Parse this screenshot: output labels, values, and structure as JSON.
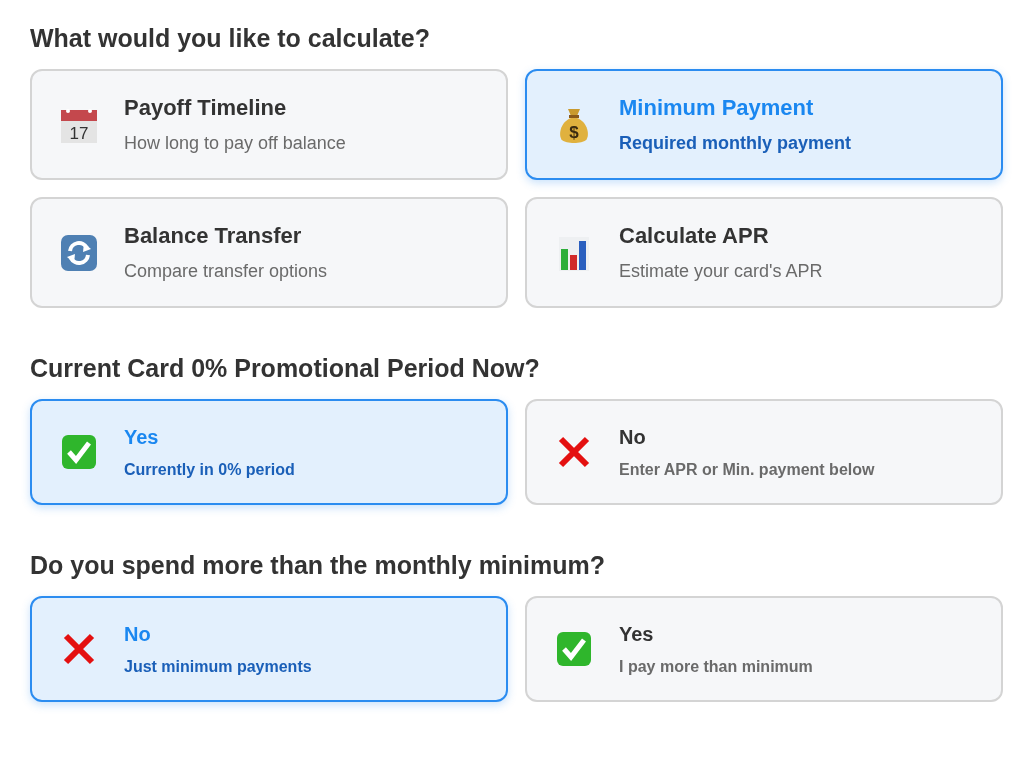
{
  "sections": [
    {
      "heading": "What would you like to calculate?",
      "kind": "large",
      "options": [
        {
          "kind": "calendar",
          "icon_text": "17",
          "title": "Payoff Timeline",
          "subtitle": "How long to pay off balance",
          "selected": false
        },
        {
          "kind": "money-bag",
          "icon_text": "$",
          "title": "Minimum Payment",
          "subtitle": "Required monthly payment",
          "selected": true
        },
        {
          "kind": "refresh",
          "title": "Balance Transfer",
          "subtitle": "Compare transfer options",
          "selected": false
        },
        {
          "kind": "bar-chart",
          "title": "Calculate APR",
          "subtitle": "Estimate your card's APR",
          "selected": false
        }
      ]
    },
    {
      "heading": "Current Card 0% Promotional Period Now?",
      "kind": "compact",
      "options": [
        {
          "kind": "check",
          "title": "Yes",
          "subtitle": "Currently in 0% period",
          "selected": true
        },
        {
          "kind": "cross",
          "title": "No",
          "subtitle": "Enter APR or Min. payment below",
          "selected": false
        }
      ]
    },
    {
      "heading": "Do you spend more than the monthly minimum?",
      "kind": "compact",
      "options": [
        {
          "kind": "cross",
          "title": "No",
          "subtitle": "Just minimum payments",
          "selected": true
        },
        {
          "kind": "check",
          "title": "Yes",
          "subtitle": "I pay more than minimum",
          "selected": false
        }
      ]
    }
  ]
}
